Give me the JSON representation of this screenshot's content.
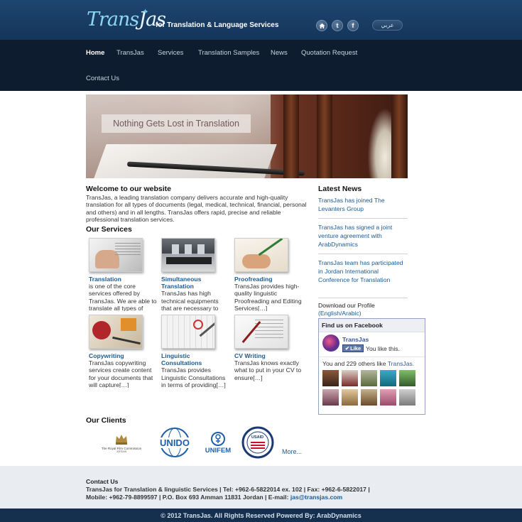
{
  "header": {
    "logo_left": "Trans",
    "logo_right": "Jas",
    "tagline": "for Translation & Language Services",
    "social_twitter": "t",
    "social_facebook": "f",
    "lang_button": "عربي"
  },
  "nav": {
    "items": [
      {
        "label": "Home"
      },
      {
        "label": "TransJas"
      },
      {
        "label": "Services"
      },
      {
        "label": "Translation Samples"
      },
      {
        "label": "News"
      },
      {
        "label": "Quotation Request"
      },
      {
        "label": "Contact Us"
      }
    ]
  },
  "banner": {
    "caption": "Nothing Gets Lost in Translation"
  },
  "welcome": {
    "title": "Welcome to our website",
    "text": "TransJas, a leading translation company delivers accurate and high-quality translation for all types of documents (legal, medical, technical, financial, personal and others) and in all lengths. TransJas offers rapid, precise and reliable professional translation services."
  },
  "services": {
    "title": "Our Services",
    "items": [
      {
        "title": "Translation",
        "text": "is one of the core services offered by TransJas. We are able to translate all types of documents"
      },
      {
        "title": "Simultaneous Translation",
        "text": "TransJas has high technical equipments that are necessary to"
      },
      {
        "title": "Proofreading",
        "text": "TransJas provides high-quality linguistic Proofreading and Editing Services[…]"
      },
      {
        "title": "Copywriting",
        "text": "TransJas copywriting services create content for your documents that will capture[…]"
      },
      {
        "title": "Linguistic Consultations",
        "text": "TransJas provides Linguistic Consultations in terms of providing[…]"
      },
      {
        "title": "CV Writing",
        "text": "TransJas knows exactly what to put in your CV to ensure[…]"
      }
    ]
  },
  "clients": {
    "title": "Our Clients",
    "royal_film_commission": "The Royal Film Commission",
    "royal_film_commission_sub": "JORDAN",
    "unido": "UNIDO",
    "unifem": "UNIFEM",
    "usaid": "USAID",
    "more": "More..."
  },
  "news": {
    "title": "Latest News",
    "items": [
      {
        "text": "TransJas has joined The Levanters Group"
      },
      {
        "text": "TransJas has signed a joint venture agreement with ArabDynamics"
      },
      {
        "text": "TransJas team has participated in Jordan International Conference for Translation"
      }
    ],
    "profile_prefix": "Download our Profile",
    "profile_link": "(English/Arabic)"
  },
  "facebook": {
    "title": "Find us on Facebook",
    "page_name": "TransJas",
    "like_button": "Like",
    "you_like": "You like this.",
    "count_prefix": "You and 229 others like",
    "count_link": "TransJas."
  },
  "footer": {
    "title": "Contact Us",
    "line1": "TransJas for Translation & linguistic Services | Tel: +962-6-5822014 ex. 102 | Fax: +962-6-5822017 |",
    "line2_prefix": "Mobile: +962-79-8899597 | P.O. Box 693 Amman 11831 Jordan | E-mail:",
    "email": "jas@transjas.com",
    "copyright": "© 2012 TransJas. All Rights Reserved Powered By: ArabDynamics"
  },
  "colors": {
    "header_bg": "#1a3f66",
    "nav_bg": "#0d1c2f",
    "link": "#1c5a92",
    "footer_bg": "#e9edf1",
    "copyright_bg": "#152f4f"
  }
}
